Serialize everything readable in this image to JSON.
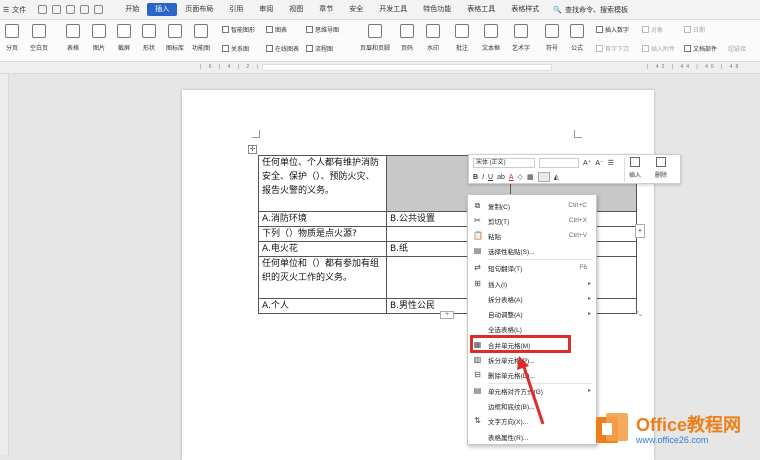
{
  "menubar": {
    "file_label": "文件",
    "tabs": [
      {
        "label": "开始",
        "active": false
      },
      {
        "label": "插入",
        "active": true
      },
      {
        "label": "页面布局",
        "active": false
      },
      {
        "label": "引用",
        "active": false
      },
      {
        "label": "审阅",
        "active": false
      },
      {
        "label": "视图",
        "active": false
      },
      {
        "label": "章节",
        "active": false
      },
      {
        "label": "安全",
        "active": false
      },
      {
        "label": "开发工具",
        "active": false
      },
      {
        "label": "特色功能",
        "active": false
      },
      {
        "label": "表格工具",
        "active": false
      },
      {
        "label": "表格样式",
        "active": false
      }
    ],
    "search_label": "查找命令、搜索模板",
    "accent_color": "#2b64c8"
  },
  "ribbon": {
    "page_break": "分页",
    "blank_page": "空白页",
    "table": "表格",
    "picture": "图片",
    "screenshot": "截屏",
    "shape": "形状",
    "icon_lib": "图标库",
    "function_chart": "功能图",
    "smart_shape": "智能图形",
    "chart": "图表",
    "mind_map": "思维导图",
    "relation_map": "关系图",
    "online_chart": "在线图表",
    "flowchart": "流程图",
    "header_footer": "页眉和页脚",
    "page_number": "页码",
    "watermark": "水印",
    "comment": "批注",
    "textbox": "文本框",
    "wordart": "艺术字",
    "symbol": "符号",
    "formula": "公式",
    "insert_number": "插入数字",
    "object": "对象",
    "date": "日期",
    "header_underline": "首字下沉",
    "attachment": "插入附件",
    "doc_parts": "文档部件",
    "hyperlink": "超链接"
  },
  "document": {
    "rows": [
      [
        "任何单位、个人都有维护消防安全、保护（）、预防火灾、报告火警的义务。",
        "",
        ""
      ],
      [
        "A.消防环境",
        "B.公共设置",
        ""
      ],
      [
        "下列（）物质是点火源?",
        "",
        ""
      ],
      [
        "A.电火花",
        "B.纸",
        ""
      ],
      [
        "任何单位和（）都有参加有组织的灭火工作的义务。",
        "",
        ""
      ],
      [
        "A.个人",
        "B.男性公民",
        ""
      ]
    ]
  },
  "mini_toolbar": {
    "font_name": "宋体 (正文)",
    "insert_label": "插入",
    "delete_label": "删除"
  },
  "context_menu": {
    "items": [
      {
        "label": "复制(C)",
        "shortcut": "Ctrl+C",
        "icon": "copy-icon",
        "submenu": false
      },
      {
        "label": "剪切(T)",
        "shortcut": "Ctrl+X",
        "icon": "cut-icon",
        "submenu": false
      },
      {
        "label": "粘贴",
        "shortcut": "Ctrl+V",
        "icon": "paste-icon",
        "submenu": false
      },
      {
        "label": "选择性粘贴(S)...",
        "shortcut": "",
        "icon": "paste-special-icon",
        "submenu": false
      },
      {
        "label": "短句翻译(T)",
        "shortcut": "F6",
        "icon": "translate-icon",
        "submenu": false
      },
      {
        "label": "插入(I)",
        "shortcut": "",
        "icon": "insert-icon",
        "submenu": true
      },
      {
        "label": "拆分表格(A)",
        "shortcut": "",
        "icon": "",
        "submenu": true
      },
      {
        "label": "自动调整(A)",
        "shortcut": "",
        "icon": "",
        "submenu": true
      },
      {
        "label": "全选表格(L)",
        "shortcut": "",
        "icon": "",
        "submenu": false
      },
      {
        "label": "合并单元格(M)",
        "shortcut": "",
        "icon": "merge-cells-icon",
        "submenu": false
      },
      {
        "label": "拆分单元格(P)...",
        "shortcut": "",
        "icon": "split-cells-icon",
        "submenu": false
      },
      {
        "label": "删除单元格(D)...",
        "shortcut": "",
        "icon": "delete-cells-icon",
        "submenu": false
      },
      {
        "label": "单元格对齐方式(G)",
        "shortcut": "",
        "icon": "cell-align-icon",
        "submenu": true
      },
      {
        "label": "边框和底纹(B)...",
        "shortcut": "",
        "icon": "",
        "submenu": false
      },
      {
        "label": "文字方向(X)...",
        "shortcut": "",
        "icon": "text-direction-icon",
        "submenu": false
      },
      {
        "label": "表格属性(R)...",
        "shortcut": "",
        "icon": "",
        "submenu": false
      }
    ]
  },
  "logo": {
    "title": "Office教程网",
    "url": "www.office26.com",
    "highlight_color": "#e02b2b"
  }
}
